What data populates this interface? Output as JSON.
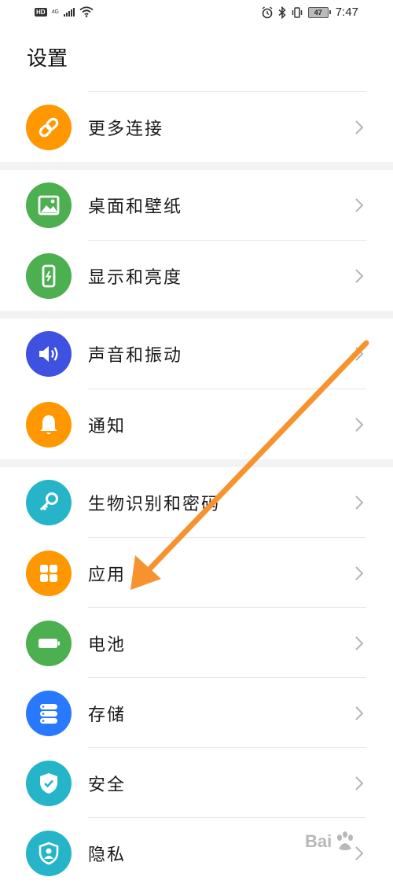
{
  "status_bar": {
    "left_badges": [
      "HD",
      "4G"
    ],
    "time": "7:47",
    "battery_level": "47",
    "icons": [
      "hd-icon",
      "network-4g-icon",
      "signal-icon",
      "wifi-icon",
      "alarm-icon",
      "bluetooth-icon",
      "vibrate-icon",
      "battery-icon"
    ]
  },
  "page": {
    "title": "设置"
  },
  "colors": {
    "orange": "#FF9800",
    "green": "#4CAF50",
    "blue_dark": "#3F51E0",
    "teal": "#26B5C8",
    "blue": "#2979FF",
    "arrow": "#F7932E",
    "section_gap": "#F3F3F3"
  },
  "menu": {
    "items": [
      {
        "label": "更多连接",
        "icon": "link-icon"
      },
      {
        "label": "桌面和壁纸",
        "icon": "image-icon"
      },
      {
        "label": "显示和亮度",
        "icon": "phone-brightness-icon"
      },
      {
        "label": "声音和振动",
        "icon": "speaker-icon"
      },
      {
        "label": "通知",
        "icon": "bell-icon"
      },
      {
        "label": "生物识别和密码",
        "icon": "key-icon"
      },
      {
        "label": "应用",
        "icon": "apps-grid-icon"
      },
      {
        "label": "电池",
        "icon": "battery-icon"
      },
      {
        "label": "存储",
        "icon": "storage-icon"
      },
      {
        "label": "安全",
        "icon": "shield-check-icon"
      },
      {
        "label": "隐私",
        "icon": "privacy-shield-icon"
      }
    ]
  },
  "watermark": {
    "text": "Bai",
    "icon": "baidu-paw-icon"
  }
}
